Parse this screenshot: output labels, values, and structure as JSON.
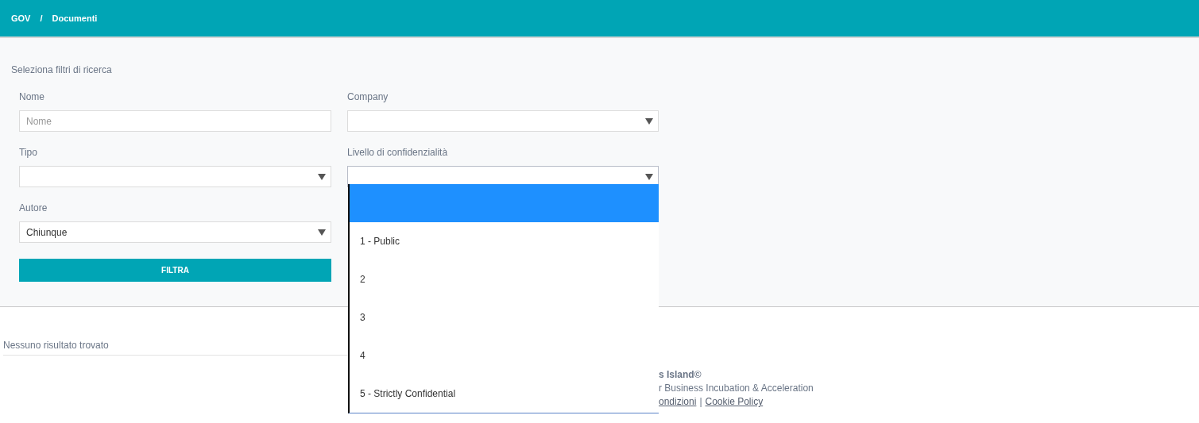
{
  "breadcrumb": [
    "GOV",
    "/",
    "Documenti"
  ],
  "filters": {
    "title": "Seleziona filtri di ricerca",
    "fields": [
      {
        "kind": "text",
        "label": "Nome",
        "placeholder": "Nome"
      },
      {
        "kind": "select",
        "label": "Company",
        "expanded": false
      },
      {
        "kind": "select",
        "label": "Tipo",
        "expanded": false
      },
      {
        "kind": "select",
        "label": "Livello di confidenzialità",
        "expanded": true
      },
      {
        "kind": "select",
        "label": "Autore",
        "value": "Chiunque",
        "expanded": false
      }
    ],
    "button": "FILTRA"
  },
  "dropdown": [
    {
      "selected": true
    },
    {
      "label": "1 - Public",
      "selected": false
    },
    {
      "label": "2",
      "selected": false
    },
    {
      "label": "3",
      "selected": false
    },
    {
      "label": "4",
      "selected": false
    },
    {
      "label": "5 - Strictly Confidential",
      "selected": false
    }
  ],
  "results": {
    "message": "Nessuno risultato trovato"
  },
  "footer": {
    "title": "s Island©",
    "tagline": "r Business Incubation & Acceleration",
    "links": [
      "ondizioni",
      "|",
      "Cookie Policy"
    ]
  }
}
